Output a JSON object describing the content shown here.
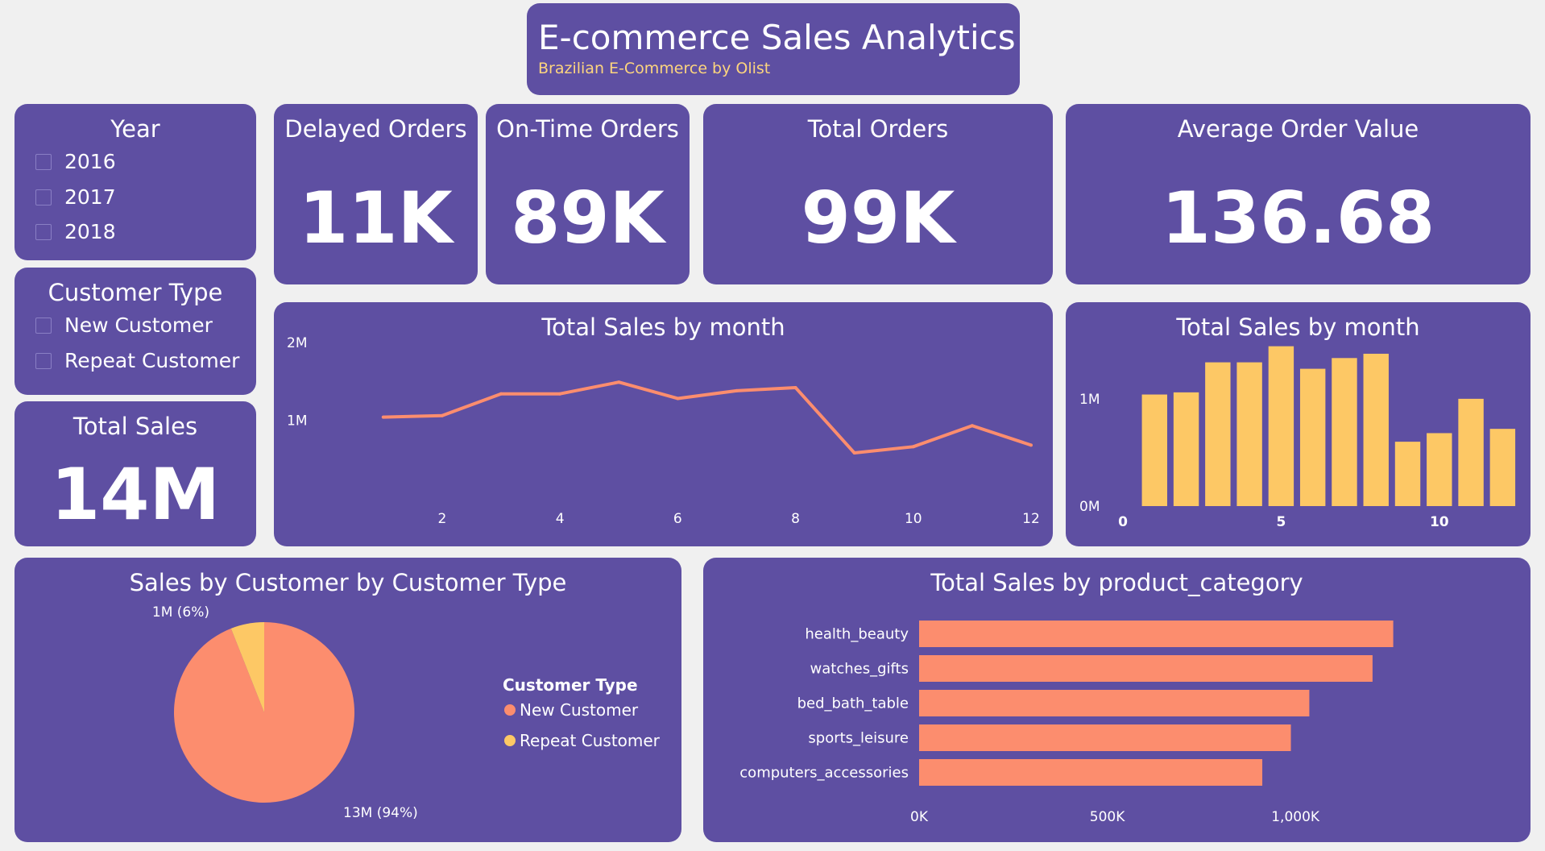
{
  "header": {
    "title": "E-commerce Sales Analytics",
    "subtitle": "Brazilian E-Commerce by Olist"
  },
  "slicers": {
    "year": {
      "title": "Year",
      "options": [
        "2016",
        "2017",
        "2018"
      ]
    },
    "customer_type": {
      "title": "Customer Type",
      "options": [
        "New Customer",
        "Repeat Customer"
      ]
    }
  },
  "kpis": {
    "total_sales": {
      "title": "Total Sales",
      "value": "14M"
    },
    "delayed_orders": {
      "title": "Delayed Orders",
      "value": "11K"
    },
    "on_time_orders": {
      "title": "On-Time Orders",
      "value": "89K"
    },
    "total_orders": {
      "title": "Total Orders",
      "value": "99K"
    },
    "avg_order_value": {
      "title": "Average Order Value",
      "value": "136.68"
    }
  },
  "colors": {
    "card_bg": "#5e4fa2",
    "page_bg": "#f0f0f0",
    "accent_salmon": "#fc8d6e",
    "accent_yellow": "#fdc865",
    "subtitle_color": "#fdd57e"
  },
  "chart_data": [
    {
      "id": "line",
      "type": "line",
      "title": "Total Sales by month",
      "x": [
        1,
        2,
        3,
        4,
        5,
        6,
        7,
        8,
        9,
        10,
        11,
        12
      ],
      "values": [
        1.04,
        1.06,
        1.34,
        1.34,
        1.49,
        1.28,
        1.38,
        1.42,
        0.58,
        0.66,
        0.93,
        0.68
      ],
      "ylim": [
        0,
        2
      ],
      "xlim": [
        0.1,
        12
      ],
      "y_tick_labels": [
        "1M",
        "2M"
      ],
      "y_ticks": [
        1,
        2
      ],
      "x_ticks": [
        2,
        4,
        6,
        8,
        10,
        12
      ],
      "x_tick_labels": [
        "2",
        "4",
        "6",
        "8",
        "10",
        "12"
      ],
      "color": "#fc8d6e"
    },
    {
      "id": "bar",
      "type": "bar",
      "title": "Total Sales by month",
      "x": [
        1,
        2,
        3,
        4,
        5,
        6,
        7,
        8,
        9,
        10,
        11,
        12
      ],
      "values": [
        1.04,
        1.06,
        1.34,
        1.34,
        1.49,
        1.28,
        1.38,
        1.42,
        0.6,
        0.68,
        1.0,
        0.72
      ],
      "ylim": [
        0,
        1.6
      ],
      "xlim": [
        0,
        12.5
      ],
      "y_ticks": [
        0,
        1
      ],
      "y_tick_labels": [
        "0M",
        "1M"
      ],
      "x_ticks": [
        0,
        5,
        10
      ],
      "x_tick_labels": [
        "0",
        "5",
        "10"
      ],
      "color": "#fdc865"
    },
    {
      "id": "pie",
      "type": "pie",
      "title": "Sales by Customer by Customer Type",
      "legend_title": "Customer Type",
      "legend_position": "right",
      "slices": [
        {
          "name": "New Customer",
          "value": 94,
          "label": "13M (94%)",
          "color": "#fc8d6e"
        },
        {
          "name": "Repeat Customer",
          "value": 6,
          "label": "1M (6%)",
          "color": "#fdc865"
        }
      ]
    },
    {
      "id": "hbar",
      "type": "bar",
      "orientation": "horizontal",
      "title": "Total Sales by product_category",
      "categories": [
        "health_beauty",
        "watches_gifts",
        "bed_bath_table",
        "sports_leisure",
        "computers_accessories"
      ],
      "values": [
        1260000,
        1205000,
        1037000,
        988000,
        912000
      ],
      "xlim": [
        0,
        1400000
      ],
      "x_ticks": [
        0,
        500000,
        1000000
      ],
      "x_tick_labels": [
        "0K",
        "500K",
        "1,000K"
      ],
      "color": "#fc8d6e"
    }
  ]
}
